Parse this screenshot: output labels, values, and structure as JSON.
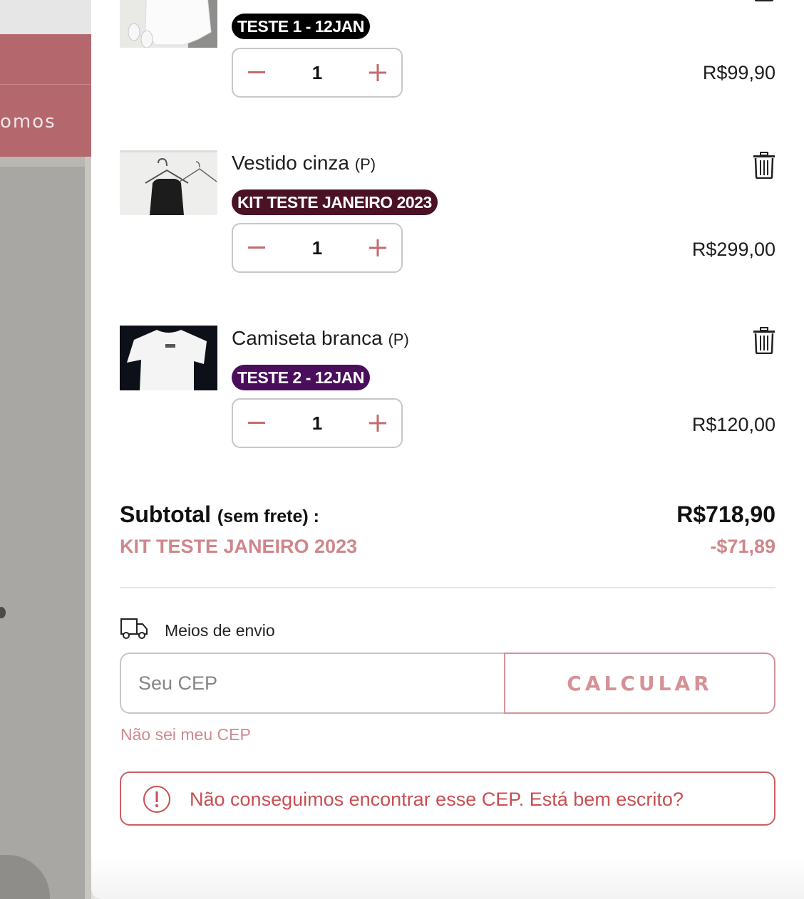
{
  "background": {
    "nav_partial_text": "omos"
  },
  "cart": {
    "items": [
      {
        "name": "",
        "size": "",
        "badge": "TESTE 1 - 12JAN",
        "badge_color": "#000000",
        "quantity": "1",
        "price": "R$99,90",
        "thumbnail": "white-sweatshirt-photo"
      },
      {
        "name": "Vestido cinza",
        "size": "(P)",
        "badge": "KIT TESTE JANEIRO 2023",
        "badge_color": "#4a1224",
        "quantity": "1",
        "price": "R$299,00",
        "thumbnail": "black-dress-on-hanger-photo"
      },
      {
        "name": "Camiseta branca",
        "size": "(P)",
        "badge": "TESTE 2 - 12JAN",
        "badge_color": "#4a0e5c",
        "quantity": "1",
        "price": "R$120,00",
        "thumbnail": "white-tshirt-photo"
      }
    ],
    "subtotal": {
      "label": "Subtotal",
      "note": "(sem frete) :",
      "value": "R$718,90"
    },
    "discount": {
      "label": "KIT TESTE JANEIRO 2023",
      "value": "-$71,89"
    }
  },
  "shipping": {
    "label": "Meios de envio",
    "icon": "truck-icon",
    "cep_placeholder": "Seu CEP",
    "calculate_label": "CALCULAR",
    "dont_know_link": "Não sei meu CEP",
    "error_message": "Não conseguimos encontrar esse CEP. Está bem escrito?"
  },
  "colors": {
    "accent": "#d08a90",
    "error": "#c94e52",
    "nav_background": "#b4686e"
  }
}
